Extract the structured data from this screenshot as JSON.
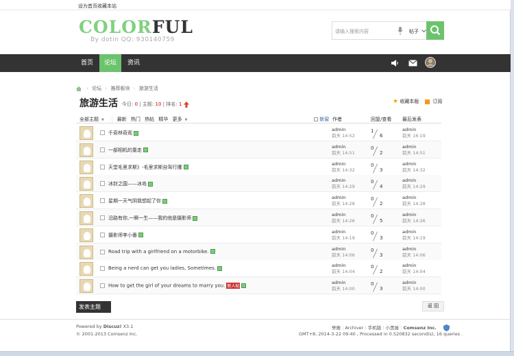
{
  "topbar": {
    "set_home": "设为首页",
    "bookmark": "收藏本站"
  },
  "logo": {
    "part1": "COLOR",
    "part2": "FUL",
    "sub": "By dotin QQ: 930140759"
  },
  "search": {
    "placeholder": "请输入搜索内容",
    "scope": "帖子"
  },
  "nav": {
    "home": "首页",
    "forum": "论坛",
    "news": "资讯"
  },
  "breadcrumb": {
    "forum": "论坛",
    "recommend": "推荐板块",
    "current": "旅游生活"
  },
  "board": {
    "title": "旅游生活",
    "today_label": "今日:",
    "today_value": "0",
    "topics_label": "| 主题:",
    "topics_value": "10",
    "rank_label": "| 排名:",
    "rank_value": "1",
    "favorite": "收藏本版",
    "subscribe": "订阅"
  },
  "filter": {
    "all": "全部主题",
    "latest": "最新",
    "hot": "热门",
    "hotpost": "热帖",
    "digest": "精华",
    "more": "更多"
  },
  "columns": {
    "new_window": "新窗",
    "author": "作者",
    "reply_view": "回复/查看",
    "last_post": "最后发表"
  },
  "threads": [
    {
      "subject": "千奇林奇观",
      "badge": "",
      "author": "admin",
      "time": "前天 14:52",
      "replies": "1",
      "views": "6",
      "last_user": "admin",
      "last_time": "前天 16:19"
    },
    {
      "subject": "一部相机的童走",
      "badge": "",
      "author": "admin",
      "time": "前天 14:51",
      "replies": "0",
      "views": "2",
      "last_user": "admin",
      "last_time": "前天 14:51"
    },
    {
      "subject": "天堂毛里求斯》-毛里求斯自驾行攫",
      "badge": "",
      "author": "admin",
      "time": "前天 14:32",
      "replies": "0",
      "views": "3",
      "last_user": "admin",
      "last_time": "前天 14:32"
    },
    {
      "subject": "冰封之国——冰岛",
      "badge": "",
      "author": "admin",
      "time": "前天 14:29",
      "replies": "0",
      "views": "4",
      "last_user": "admin",
      "last_time": "前天 14:29"
    },
    {
      "subject": "星期一天气阴我想起了你",
      "badge": "",
      "author": "admin",
      "time": "前天 14:28",
      "replies": "0",
      "views": "2",
      "last_user": "admin",
      "last_time": "前天 14:28"
    },
    {
      "subject": "沿路有你,一瞬一生——我的他是摄影师",
      "badge": "",
      "author": "admin",
      "time": "前天 14:26",
      "replies": "0",
      "views": "5",
      "last_user": "admin",
      "last_time": "前天 14:26"
    },
    {
      "subject": "摄影师李小番",
      "badge": "",
      "author": "admin",
      "time": "前天 14:19",
      "replies": "0",
      "views": "3",
      "last_user": "admin",
      "last_time": "前天 14:19"
    },
    {
      "subject": "Road trip with a girlfriend on a motorbike.",
      "badge": "",
      "author": "admin",
      "time": "前天 14:06",
      "replies": "0",
      "views": "3",
      "last_user": "admin",
      "last_time": "前天 14:06"
    },
    {
      "subject": "Being a nerd can get you ladies, Sometimes.",
      "badge": "",
      "author": "admin",
      "time": "前天 14:04",
      "replies": "0",
      "views": "2",
      "last_user": "admin",
      "last_time": "前天 14:04"
    },
    {
      "subject": "How to get the girl of your dreams to marry you.",
      "badge": "新人帖",
      "author": "admin",
      "time": "前天 14:00",
      "replies": "0",
      "views": "3",
      "last_user": "admin",
      "last_time": "前天 14:00"
    }
  ],
  "actions": {
    "post": "发表主题",
    "back": "返 回"
  },
  "footer": {
    "powered": "Powered by",
    "discuz": "Discuz!",
    "version": "X3.1",
    "copyright": "© 2001-2013 Comsenz Inc.",
    "links": [
      "举报",
      "Archiver",
      "手机版",
      "小黑屋"
    ],
    "company": "Comsenz Inc.",
    "gmt": "GMT+8, 2014-3-22 09:40 , Processed in 0.520832 second(s), 16 queries ."
  },
  "colors": {
    "accent": "#6cc36d",
    "nav_bg": "#333333",
    "logo_green": "#7fd17f"
  }
}
